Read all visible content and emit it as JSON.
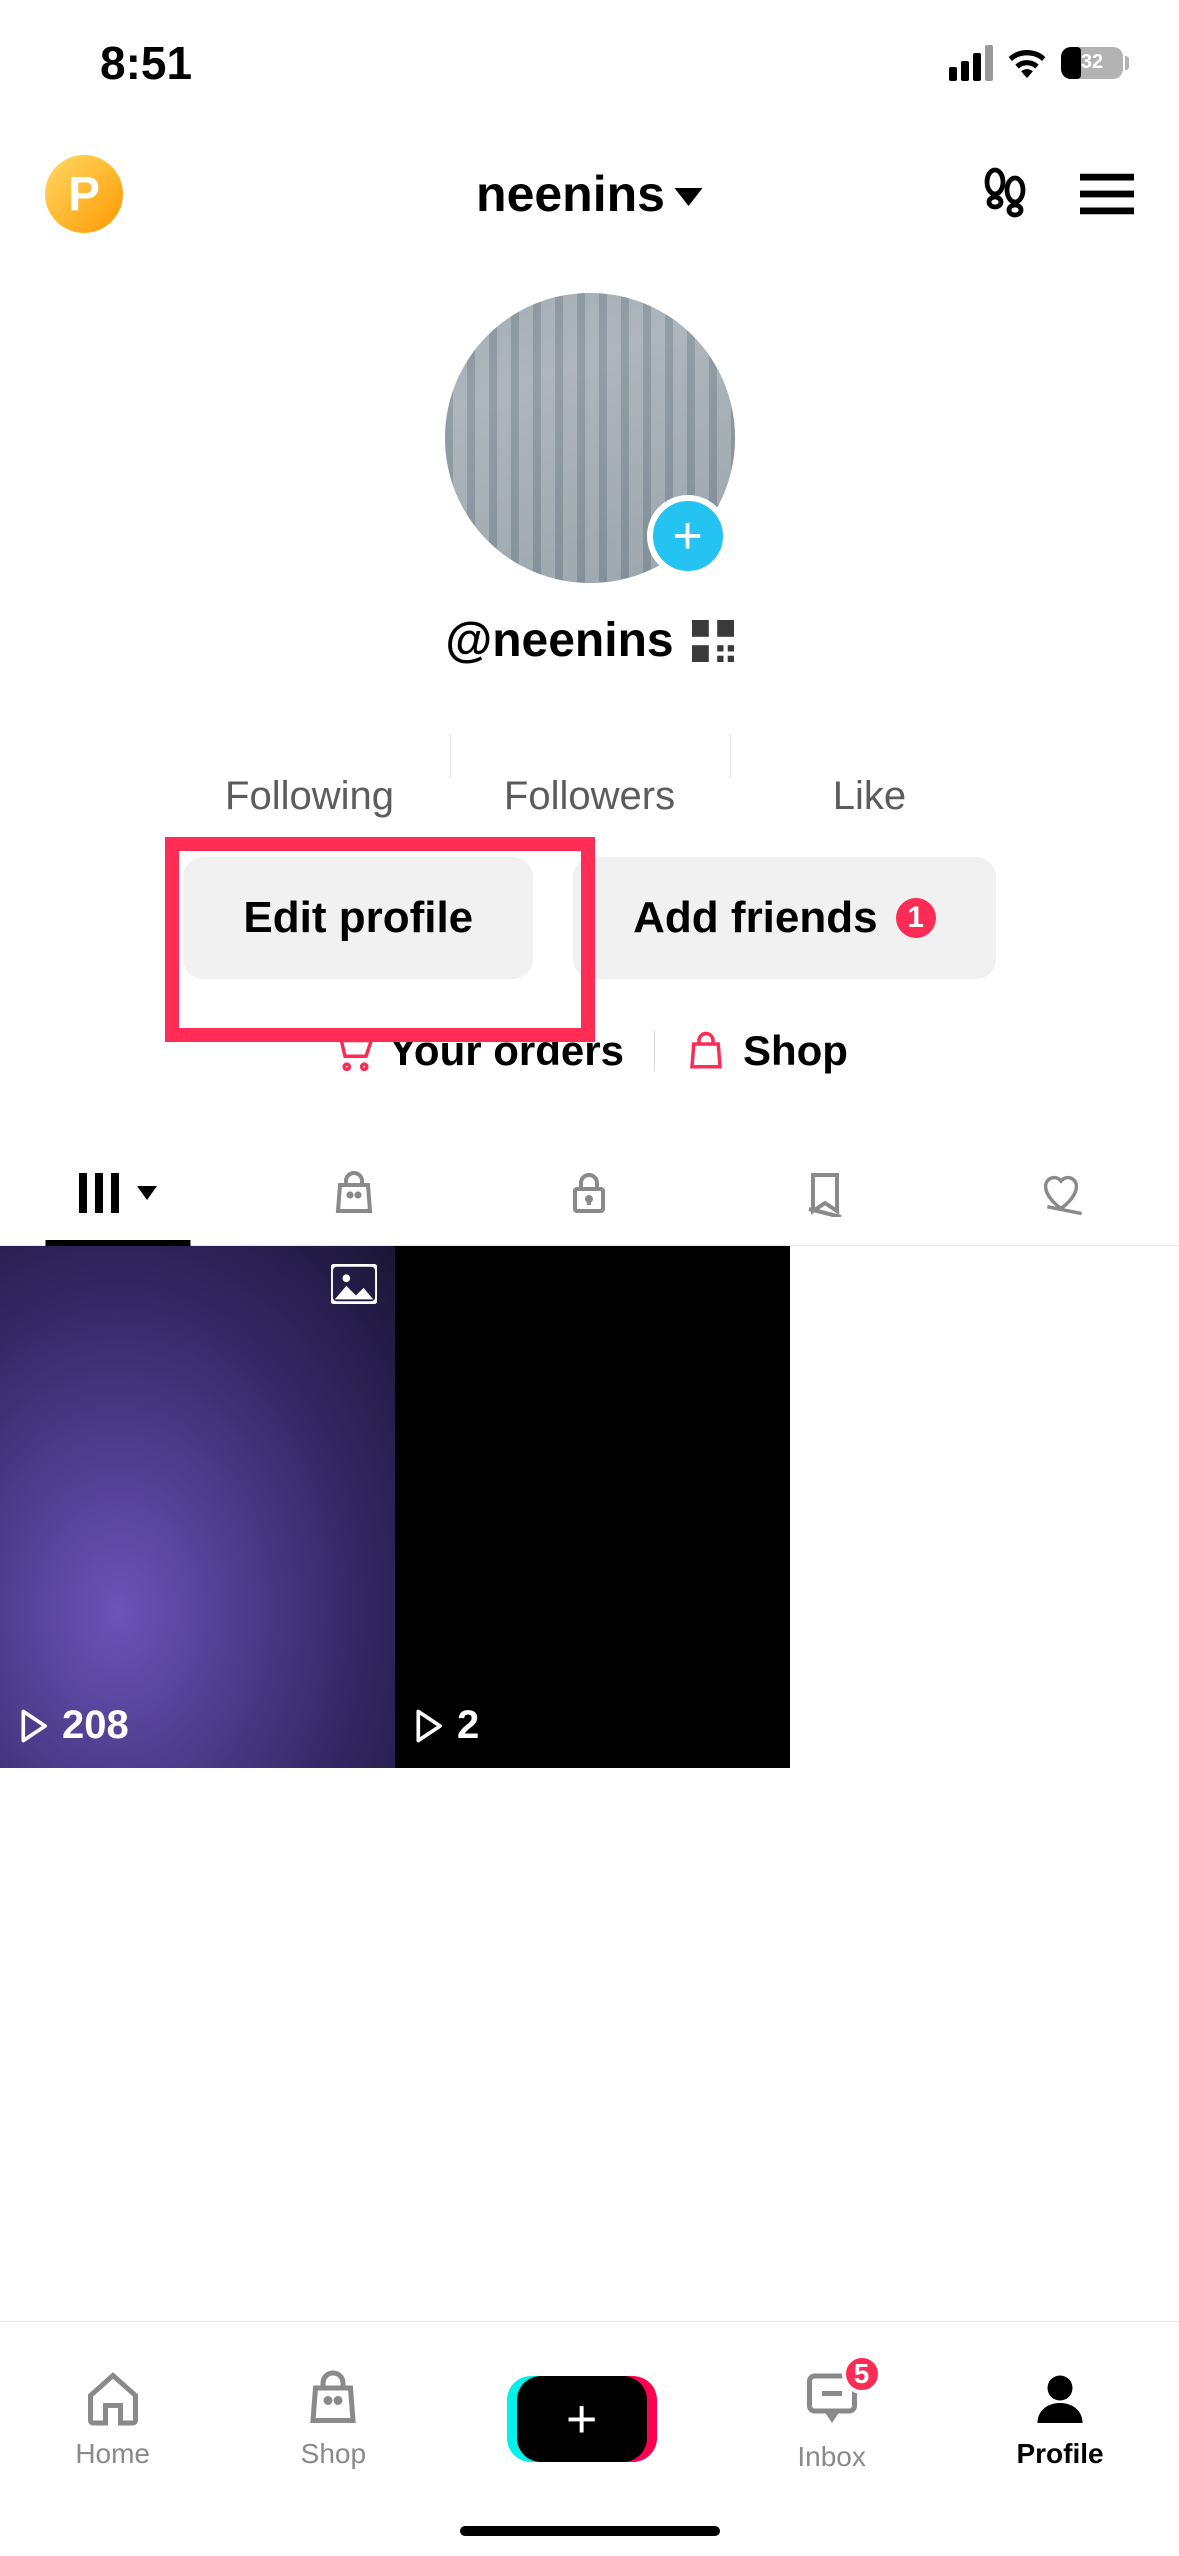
{
  "status": {
    "time": "8:51",
    "battery_pct": "32"
  },
  "header": {
    "username": "neenins"
  },
  "handle": {
    "text": "@neenins"
  },
  "stats": {
    "following": {
      "label": "Following"
    },
    "followers": {
      "label": "Followers"
    },
    "likes": {
      "label": "Like"
    }
  },
  "actions": {
    "edit_profile": "Edit profile",
    "add_friends": "Add friends",
    "add_friends_badge": "1"
  },
  "links": {
    "orders": "Your orders",
    "shop": "Shop"
  },
  "videos": [
    {
      "views": "208"
    },
    {
      "views": "2"
    }
  ],
  "nav": {
    "home": "Home",
    "shop": "Shop",
    "inbox": "Inbox",
    "inbox_badge": "5",
    "profile": "Profile"
  }
}
